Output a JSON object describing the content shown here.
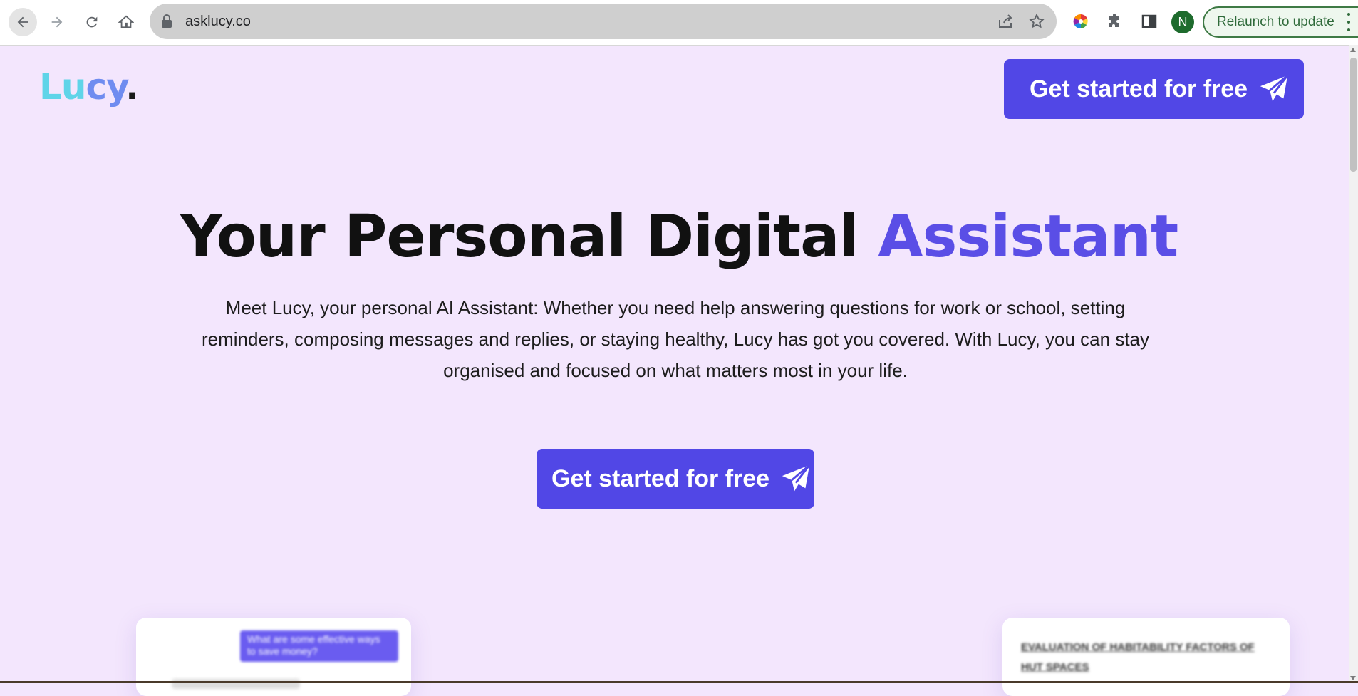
{
  "browser": {
    "url": "asklucy.co",
    "profile_initial": "N",
    "relaunch_label": "Relaunch to update"
  },
  "page": {
    "logo": {
      "part1": "Lu",
      "part2": "cy",
      "dot": "."
    },
    "header_cta": "Get started for free",
    "hero": {
      "title_main": "Your Personal Digital",
      "title_accent": "Assistant",
      "description": "Meet Lucy, your personal AI Assistant: Whether you need help answering questions for work or school, setting reminders, composing messages and replies, or staying healthy, Lucy has got you covered. With Lucy, you can stay organised and focused on what matters most in your life."
    },
    "main_cta": "Get started for free",
    "cards": {
      "left_bubble": "What are some effective ways to save money?",
      "right_text": "EVALUATION OF HABITABILITY FACTORS OF HUT SPACES"
    }
  },
  "colors": {
    "background": "#f3e6fd",
    "primary": "#5147e6",
    "accent_text": "#5a4ee6",
    "logo_cyan": "#5fd4e8",
    "logo_blue": "#6f8cf0"
  }
}
